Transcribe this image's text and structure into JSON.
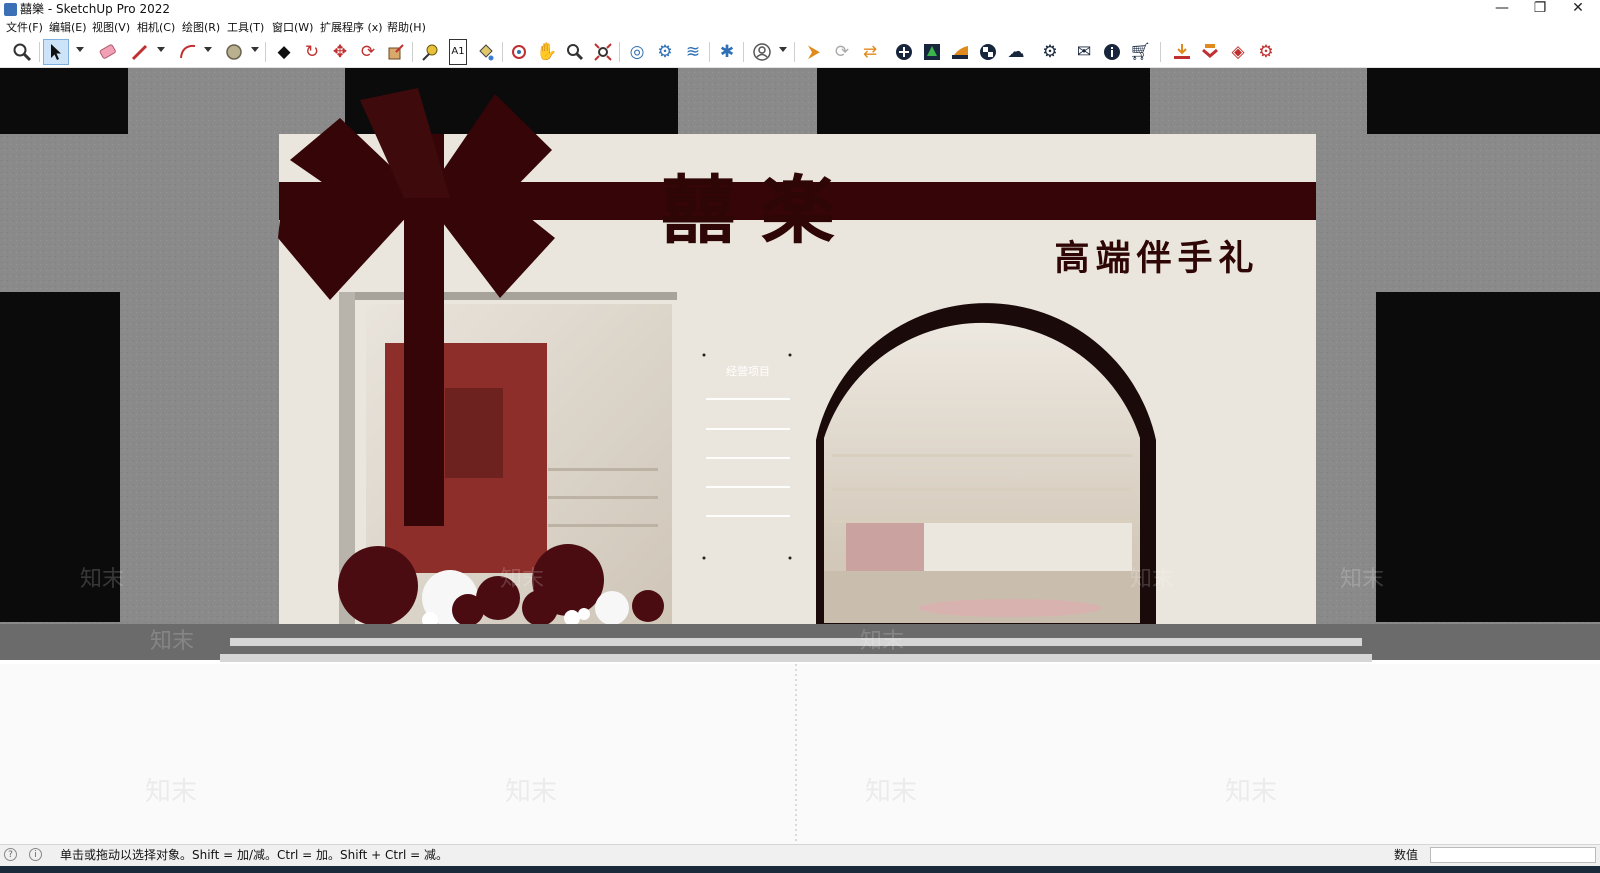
{
  "window": {
    "title": "囍樂 - SketchUp Pro 2022",
    "controls": {
      "minimize": "—",
      "restore": "❐",
      "close": "✕"
    }
  },
  "menu": [
    "文件(F)",
    "编辑(E)",
    "视图(V)",
    "相机(C)",
    "绘图(R)",
    "工具(T)",
    "窗口(W)",
    "扩展程序 (x)",
    "帮助(H)"
  ],
  "toolbar": {
    "icons": [
      "zoom-magnifier",
      "select-arrow",
      "eraser",
      "pencil-line",
      "arc",
      "circle-shape",
      "paint-bucket",
      "push-pull",
      "move",
      "rotate",
      "scale",
      "tape-measure",
      "text-label",
      "paint-bucket-2",
      "orbit",
      "pan-hand",
      "zoom",
      "zoom-extents",
      "warehouse",
      "extension-warehouse",
      "layers",
      "components",
      "profile",
      "add-location",
      "refresh",
      "export",
      "plus-circle",
      "tree",
      "stairs",
      "checker",
      "cloud-upload",
      "gear",
      "mail",
      "info",
      "cart",
      "import",
      "shelf",
      "plugin-red",
      "plugin-gear"
    ]
  },
  "scene": {
    "sign_main": "囍 楽",
    "sign_sub": "高端伴手礼",
    "panel_heading": "经营项目",
    "panel_lines": 5,
    "watermark": "知末",
    "colors": {
      "burgundy": "#350507",
      "wall": "#ebe6dd",
      "concrete": "#8c8c8c",
      "dark": "#0b0b0b"
    }
  },
  "status": {
    "hint": "单击或拖动以选择对象。Shift = 加/减。Ctrl = 加。Shift + Ctrl = 减。",
    "measurements_label": "数值",
    "measurements_value": ""
  }
}
